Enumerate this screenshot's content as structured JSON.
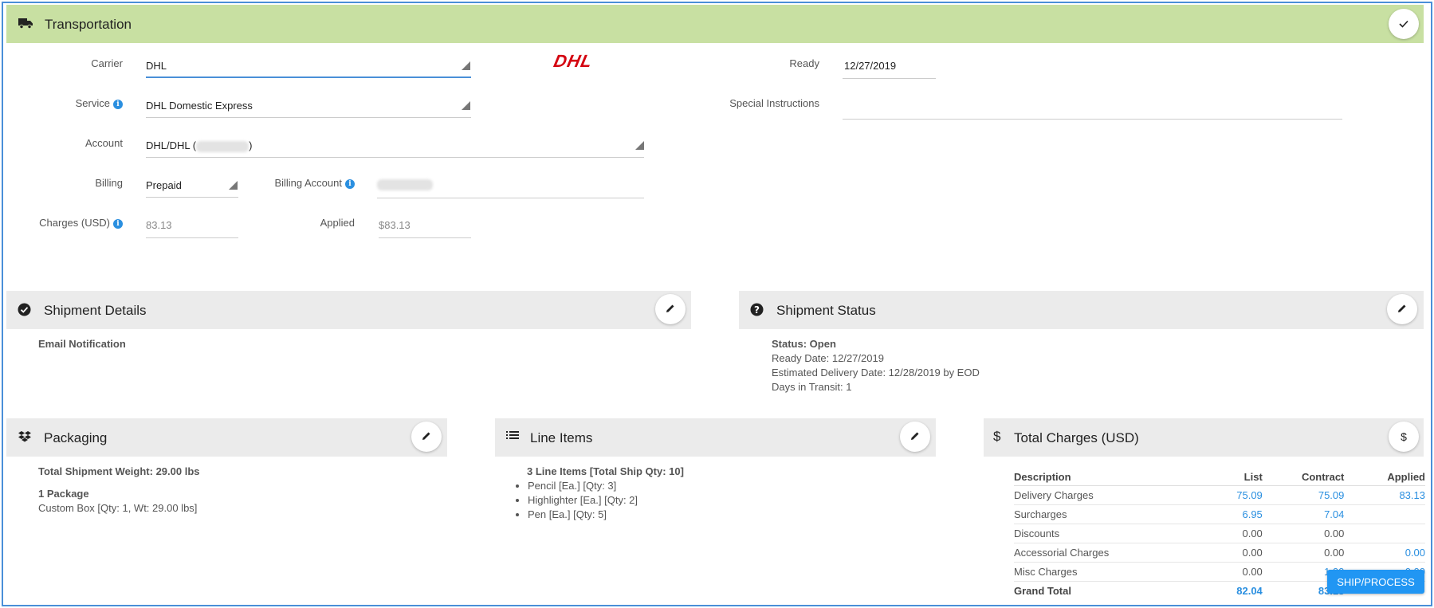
{
  "transportation": {
    "title": "Transportation",
    "carrier_label": "Carrier",
    "carrier_value": "DHL",
    "carrier_logo_text": "DHL",
    "service_label": "Service",
    "service_value": "DHL Domestic Express",
    "account_label": "Account",
    "account_prefix": "DHL/DHL (",
    "account_suffix": ")",
    "billing_label": "Billing",
    "billing_value": "Prepaid",
    "billing_account_label": "Billing Account",
    "charges_label": "Charges (USD)",
    "charges_value": "83.13",
    "applied_label": "Applied",
    "applied_value": "$83.13",
    "ready_label": "Ready",
    "ready_value": "12/27/2019",
    "special_instructions_label": "Special Instructions",
    "special_instructions_value": ""
  },
  "shipment_details": {
    "title": "Shipment Details",
    "email_notification": "Email Notification"
  },
  "shipment_status": {
    "title": "Shipment Status",
    "status": "Status: Open",
    "ready_date": "Ready Date: 12/27/2019",
    "estimated_delivery": "Estimated Delivery Date: 12/28/2019 by EOD",
    "days_in_transit": "Days in Transit: 1"
  },
  "packaging": {
    "title": "Packaging",
    "total_weight": "Total Shipment Weight: 29.00 lbs",
    "package_count": "1 Package",
    "package_detail": "Custom Box [Qty: 1, Wt: 29.00 lbs]"
  },
  "line_items": {
    "title": "Line Items",
    "summary": "3 Line Items [Total Ship Qty: 10]",
    "items": [
      "Pencil [Ea.] [Qty: 3]",
      "Highlighter [Ea.] [Qty: 2]",
      "Pen [Ea.] [Qty: 5]"
    ]
  },
  "total_charges": {
    "title": "Total Charges (USD)",
    "columns": [
      "Description",
      "List",
      "Contract",
      "Applied"
    ],
    "rows": [
      [
        "Delivery Charges",
        "75.09",
        "75.09",
        "83.13"
      ],
      [
        "Surcharges",
        "6.95",
        "7.04",
        ""
      ],
      [
        "Discounts",
        "0.00",
        "0.00",
        ""
      ],
      [
        "Accessorial Charges",
        "0.00",
        "0.00",
        "0.00"
      ],
      [
        "Misc Charges",
        "0.00",
        "1.00",
        "0.00"
      ],
      [
        "Grand Total",
        "82.04",
        "83.13",
        ""
      ]
    ]
  },
  "ship_button": "SHIP/PROCESS",
  "colors": {
    "transport_header_bg": "#c8e0a2",
    "section_header_bg": "#ebebeb",
    "link_blue": "#2a8fe0",
    "dhl_red": "#d40511",
    "ship_button_bg": "#2196f3"
  }
}
